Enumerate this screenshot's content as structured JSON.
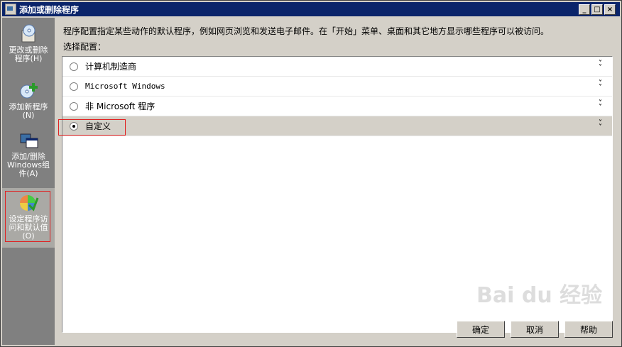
{
  "window": {
    "title": "添加或删除程序"
  },
  "titlebar_buttons": [
    "_",
    "□",
    "×"
  ],
  "sidebar": {
    "items": [
      {
        "label": "更改或删除程序(H)",
        "icon": "cd-box-icon",
        "active": false
      },
      {
        "label": "添加新程序(N)",
        "icon": "cd-add-icon",
        "active": false
      },
      {
        "label": "添加/删除Windows组件(A)",
        "icon": "windows-components-icon",
        "active": false
      },
      {
        "label": "设定程序访问和默认值(O)",
        "icon": "program-defaults-icon",
        "active": true
      }
    ]
  },
  "main": {
    "description": "程序配置指定某些动作的默认程序，例如网页浏览和发送电子邮件。在「开始」菜单、桌面和其它地方显示哪些程序可以被访问。",
    "select_label": "选择配置：",
    "configurations": [
      {
        "label": "计算机制造商",
        "selected": false
      },
      {
        "label": "Microsoft Windows",
        "selected": false
      },
      {
        "label": "非 Microsoft 程序",
        "selected": false
      },
      {
        "label": "自定义",
        "selected": true
      }
    ]
  },
  "buttons": {
    "ok": "确定",
    "cancel": "取消",
    "help": "帮助"
  },
  "watermark": "Bai du 经验",
  "colors": {
    "titlebar": "#0a246a",
    "sidebar": "#808080",
    "highlight_box": "#e02020"
  }
}
